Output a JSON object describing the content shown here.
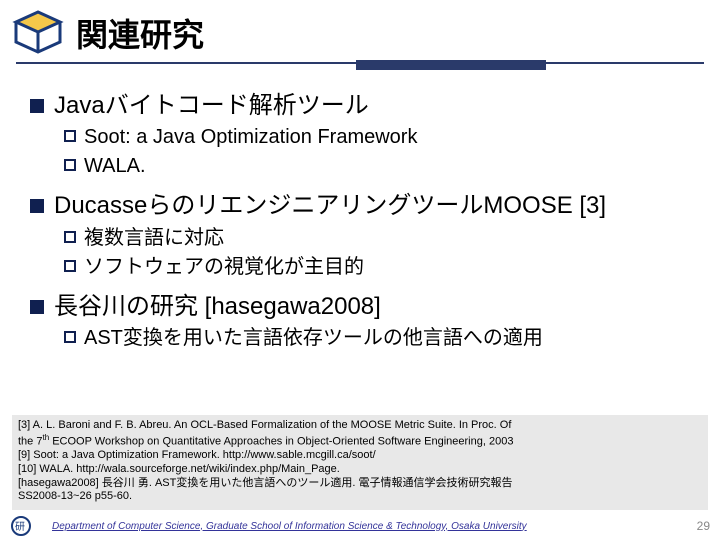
{
  "title": "関連研究",
  "sections": [
    {
      "heading": "Javaバイトコード解析ツール",
      "items": [
        "Soot: a Java Optimization Framework",
        "WALA."
      ]
    },
    {
      "heading": "DucasseらのリエンジニアリングツールMOOSE [3]",
      "items": [
        "複数言語に対応",
        "ソフトウェアの視覚化が主目的"
      ]
    },
    {
      "heading": "長谷川の研究 [hasegawa2008]",
      "items": [
        "AST変換を用いた言語依存ツールの他言語への適用"
      ]
    }
  ],
  "refs": {
    "r3a": "[3]  A. L. Baroni and F. B. Abreu. An OCL-Based Formalization of the MOOSE  Metric Suite. In Proc. Of",
    "r3b_pre": "the 7",
    "r3b_sup": "th",
    "r3b_post": " ECOOP Workshop on Quantitative Approaches in Object-Oriented Software Engineering, 2003",
    "r9": "[9] Soot: a Java Optimization Framework. http://www.sable.mcgill.ca/soot/",
    "r10": "[10] WALA. http://wala.sourceforge.net/wiki/index.php/Main_Page.",
    "rh1": "[hasegawa2008]  長谷川 勇. AST変換を用いた他言語へのツール適用.  電子情報通信学会技術研究報告",
    "rh2": "SS2008-13~26 p55-60."
  },
  "footer": {
    "dept": "Department of Computer Science, Graduate School of Information Science & Technology, Osaka University",
    "page": "29"
  }
}
